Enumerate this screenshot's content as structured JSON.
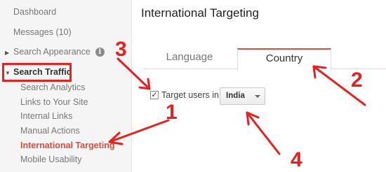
{
  "sidebar": {
    "dashboard": "Dashboard",
    "messages": "Messages (10)",
    "search_appearance": "Search Appearance",
    "search_traffic": "Search Traffic",
    "items": [
      {
        "label": "Search Analytics"
      },
      {
        "label": "Links to Your Site"
      },
      {
        "label": "Internal Links"
      },
      {
        "label": "Manual Actions"
      },
      {
        "label": "International Targeting"
      },
      {
        "label": "Mobile Usability"
      }
    ]
  },
  "main": {
    "title": "International Targeting",
    "tabs": [
      {
        "label": "Language"
      },
      {
        "label": "Country"
      }
    ],
    "target_label": "Target users in:",
    "country_select": "India"
  },
  "annotations": {
    "labels": [
      "1",
      "2",
      "3",
      "4"
    ],
    "color": "#e8201f"
  },
  "colors": {
    "accent": "#dd4b39",
    "annotation": "#e8201f"
  }
}
